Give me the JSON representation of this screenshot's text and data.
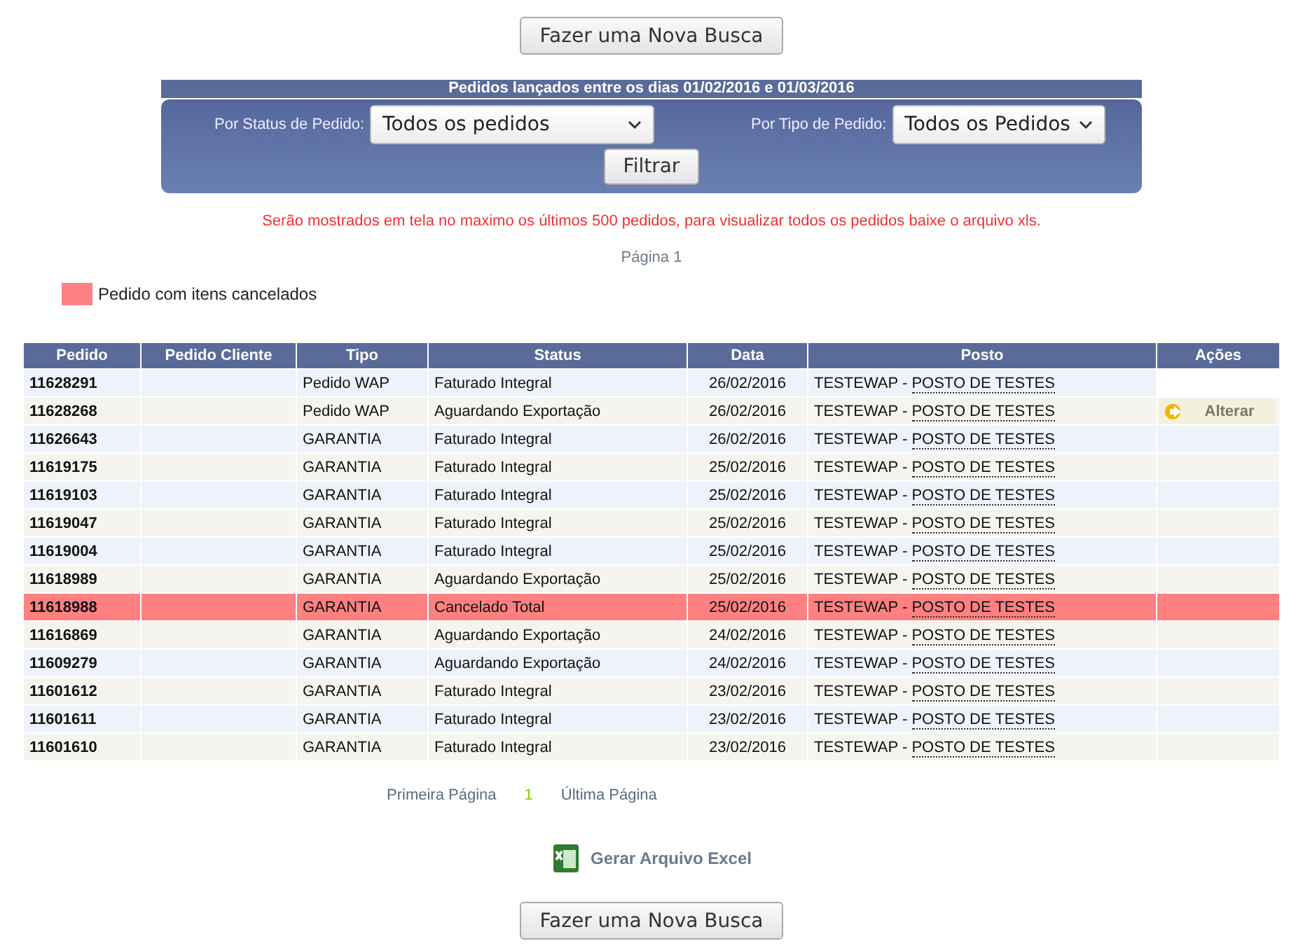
{
  "top_button": "Fazer uma Nova Busca",
  "filter": {
    "title": "Pedidos lançados entre os dias 01/02/2016 e 01/03/2016",
    "status_label": "Por Status de Pedido:",
    "status_value": "Todos os pedidos",
    "type_label": "Por Tipo de Pedido:",
    "type_value": "Todos os Pedidos",
    "button": "Filtrar"
  },
  "notice": "Serão mostrados em tela no maximo os últimos 500 pedidos, para visualizar todos os pedidos baixe o arquivo xls.",
  "page_label": "Página 1",
  "legend": {
    "label": "Pedido com itens cancelados",
    "color": "#ff8080"
  },
  "table": {
    "columns": [
      "Pedido",
      "Pedido Cliente",
      "Tipo",
      "Status",
      "Data",
      "Posto",
      "Ações"
    ],
    "rows": [
      {
        "pedido": "11628291",
        "tipo": "Pedido WAP",
        "status": "Faturado Integral",
        "data": "26/02/2016",
        "posto_code": "TESTEWAP -",
        "posto_name": "POSTO DE TESTES",
        "cancelled": false
      },
      {
        "pedido": "11628268",
        "tipo": "Pedido WAP",
        "status": "Aguardando Exportação",
        "data": "26/02/2016",
        "posto_code": "TESTEWAP -",
        "posto_name": "POSTO DE TESTES",
        "cancelled": false,
        "action": "Alterar"
      },
      {
        "pedido": "11626643",
        "tipo": "GARANTIA",
        "status": "Faturado Integral",
        "data": "26/02/2016",
        "posto_code": "TESTEWAP -",
        "posto_name": "POSTO DE TESTES",
        "cancelled": false
      },
      {
        "pedido": "11619175",
        "tipo": "GARANTIA",
        "status": "Faturado Integral",
        "data": "25/02/2016",
        "posto_code": "TESTEWAP -",
        "posto_name": "POSTO DE TESTES",
        "cancelled": false
      },
      {
        "pedido": "11619103",
        "tipo": "GARANTIA",
        "status": "Faturado Integral",
        "data": "25/02/2016",
        "posto_code": "TESTEWAP -",
        "posto_name": "POSTO DE TESTES",
        "cancelled": false
      },
      {
        "pedido": "11619047",
        "tipo": "GARANTIA",
        "status": "Faturado Integral",
        "data": "25/02/2016",
        "posto_code": "TESTEWAP -",
        "posto_name": "POSTO DE TESTES",
        "cancelled": false
      },
      {
        "pedido": "11619004",
        "tipo": "GARANTIA",
        "status": "Faturado Integral",
        "data": "25/02/2016",
        "posto_code": "TESTEWAP -",
        "posto_name": "POSTO DE TESTES",
        "cancelled": false
      },
      {
        "pedido": "11618989",
        "tipo": "GARANTIA",
        "status": "Aguardando Exportação",
        "data": "25/02/2016",
        "posto_code": "TESTEWAP -",
        "posto_name": "POSTO DE TESTES",
        "cancelled": false
      },
      {
        "pedido": "11618988",
        "tipo": "GARANTIA",
        "status": "Cancelado Total",
        "data": "25/02/2016",
        "posto_code": "TESTEWAP -",
        "posto_name": "POSTO DE TESTES",
        "cancelled": true
      },
      {
        "pedido": "11616869",
        "tipo": "GARANTIA",
        "status": "Aguardando Exportação",
        "data": "24/02/2016",
        "posto_code": "TESTEWAP -",
        "posto_name": "POSTO DE TESTES",
        "cancelled": false
      },
      {
        "pedido": "11609279",
        "tipo": "GARANTIA",
        "status": "Aguardando Exportação",
        "data": "24/02/2016",
        "posto_code": "TESTEWAP -",
        "posto_name": "POSTO DE TESTES",
        "cancelled": false
      },
      {
        "pedido": "11601612",
        "tipo": "GARANTIA",
        "status": "Faturado Integral",
        "data": "23/02/2016",
        "posto_code": "TESTEWAP -",
        "posto_name": "POSTO DE TESTES",
        "cancelled": false
      },
      {
        "pedido": "11601611",
        "tipo": "GARANTIA",
        "status": "Faturado Integral",
        "data": "23/02/2016",
        "posto_code": "TESTEWAP -",
        "posto_name": "POSTO DE TESTES",
        "cancelled": false
      },
      {
        "pedido": "11601610",
        "tipo": "GARANTIA",
        "status": "Faturado Integral",
        "data": "23/02/2016",
        "posto_code": "TESTEWAP -",
        "posto_name": "POSTO DE TESTES",
        "cancelled": false
      }
    ]
  },
  "pagination": {
    "first": "Primeira Página",
    "current": "1",
    "last": "Última Página"
  },
  "excel_link": "Gerar Arquivo Excel",
  "bottom_button": "Fazer uma Nova Busca"
}
